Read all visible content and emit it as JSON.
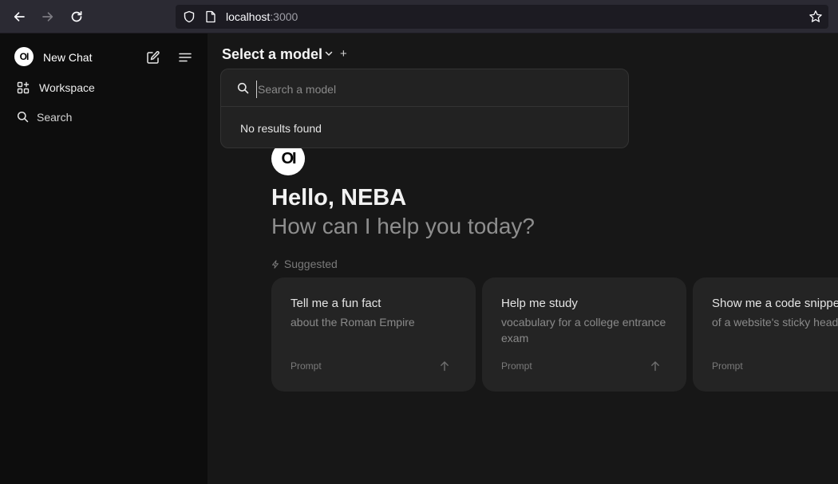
{
  "browser": {
    "url_host": "localhost",
    "url_port": ":3000"
  },
  "sidebar": {
    "logo_text": "OI",
    "new_chat_label": "New Chat",
    "workspace_label": "Workspace",
    "search_label": "Search"
  },
  "header": {
    "model_select_label": "Select a model",
    "add_symbol": "+"
  },
  "model_dropdown": {
    "search_placeholder": "Search a model",
    "search_value": "",
    "empty_message": "No results found"
  },
  "greeting": {
    "logo_text": "OI",
    "hello": "Hello, NEBA",
    "subtitle": "How can I help you today?",
    "suggested_label": "Suggested"
  },
  "suggestions": [
    {
      "title": "Tell me a fun fact",
      "description": "about the Roman Empire",
      "type": "Prompt"
    },
    {
      "title": "Help me study",
      "description": "vocabulary for a college entrance exam",
      "type": "Prompt"
    },
    {
      "title": "Show me a code snippet",
      "description": "of a website's sticky header",
      "type": "Prompt"
    }
  ],
  "colors": {
    "sidebar_bg": "#0d0d0d",
    "main_bg": "#171717",
    "card_bg": "#242424",
    "browser_bar_bg": "#2b2a33"
  }
}
